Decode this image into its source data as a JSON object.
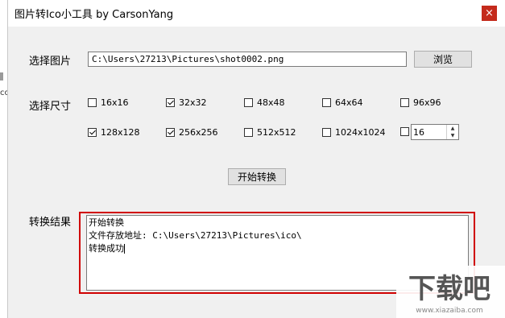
{
  "background": {
    "side_text": "co"
  },
  "window": {
    "title": "图片转Ico小工具 by CarsonYang",
    "close_glyph": "×"
  },
  "image_row": {
    "label": "选择图片",
    "path_value": "C:\\Users\\27213\\Pictures\\shot0002.png",
    "browse_label": "浏览"
  },
  "size_row": {
    "label": "选择尺寸",
    "options": [
      {
        "label": "16x16",
        "checked": false
      },
      {
        "label": "32x32",
        "checked": true
      },
      {
        "label": "48x48",
        "checked": false
      },
      {
        "label": "64x64",
        "checked": false
      },
      {
        "label": "96x96",
        "checked": false
      },
      {
        "label": "128x128",
        "checked": true
      },
      {
        "label": "256x256",
        "checked": true
      },
      {
        "label": "512x512",
        "checked": false
      },
      {
        "label": "1024x1024",
        "checked": false
      }
    ],
    "custom_checked": false,
    "custom_value": "16"
  },
  "start_button_label": "开始转换",
  "result": {
    "label": "转换结果",
    "lines": [
      "开始转换",
      "文件存放地址: C:\\Users\\27213\\Pictures\\ico\\",
      "转换成功"
    ]
  },
  "watermark": {
    "text": "下载吧",
    "sub": "www.xiazaiba.com"
  },
  "colors": {
    "highlight_border": "#d00000",
    "close_button": "#c42b1c",
    "window_bg": "#f0f0f0"
  }
}
